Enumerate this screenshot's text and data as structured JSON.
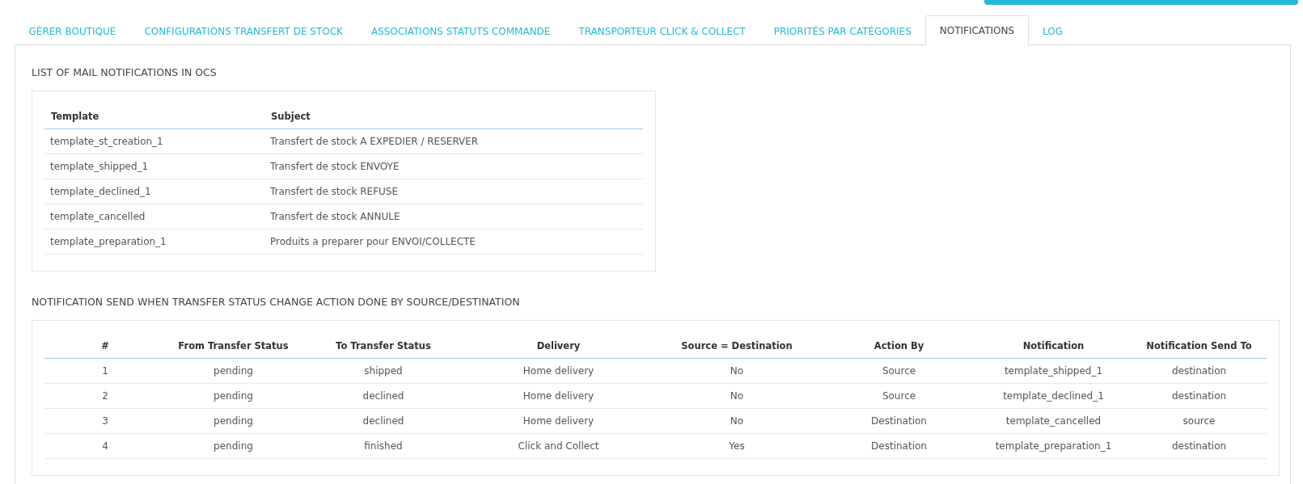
{
  "tabs": [
    {
      "label": "GÉRER BOUTIQUE",
      "selected": false
    },
    {
      "label": "CONFIGURATIONS TRANSFERT DE STOCK",
      "selected": false
    },
    {
      "label": "ASSOCIATIONS STATUTS COMMANDE",
      "selected": false
    },
    {
      "label": "TRANSPORTEUR CLICK & COLLECT",
      "selected": false
    },
    {
      "label": "PRIORITÉS PAR CATÉGORIES",
      "selected": false
    },
    {
      "label": "NOTIFICATIONS",
      "selected": true
    },
    {
      "label": "LOG",
      "selected": false
    }
  ],
  "mail_notifications": {
    "title": "LIST OF MAIL NOTIFICATIONS IN OCS",
    "table": {
      "columns": [
        "Template",
        "Subject"
      ],
      "rows": [
        [
          "template_st_creation_1",
          "Transfert de stock A EXPEDIER / RESERVER"
        ],
        [
          "template_shipped_1",
          "Transfert de stock ENVOYE"
        ],
        [
          "template_declined_1",
          "Transfert de stock REFUSE"
        ],
        [
          "template_cancelled",
          "Transfert de stock ANNULE"
        ],
        [
          "template_preparation_1",
          "Produits a preparer pour ENVOI/COLLECTE"
        ]
      ]
    }
  },
  "status_notifications": {
    "title": "NOTIFICATION SEND WHEN TRANSFER STATUS CHANGE ACTION DONE BY SOURCE/DESTINATION",
    "table": {
      "columns": [
        "#",
        "From Transfer Status",
        "To Transfer Status",
        "Delivery",
        "Source = Destination",
        "Action By",
        "Notification",
        "Notification Send To"
      ],
      "rows": [
        [
          "1",
          "pending",
          "shipped",
          "Home delivery",
          "No",
          "Source",
          "template_shipped_1",
          "destination"
        ],
        [
          "2",
          "pending",
          "declined",
          "Home delivery",
          "No",
          "Source",
          "template_declined_1",
          "destination"
        ],
        [
          "3",
          "pending",
          "declined",
          "Home delivery",
          "No",
          "Destination",
          "template_cancelled",
          "source"
        ],
        [
          "4",
          "pending",
          "finished",
          "Click and Collect",
          "Yes",
          "Destination",
          "template_preparation_1",
          "destination"
        ]
      ]
    }
  }
}
